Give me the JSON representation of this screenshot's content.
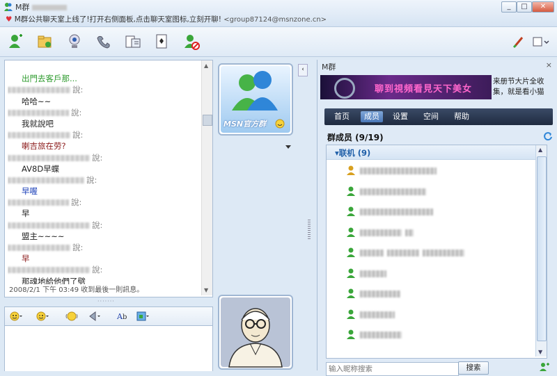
{
  "window": {
    "title": "M群",
    "announcement": "M群公共聊天室上线了!打开右侧面板,点击聊天室图标,立刻开聊!",
    "email": "<group87124@msnzone.cn>",
    "min_label": "_",
    "max_label": "□",
    "close_label": "✕"
  },
  "chat": {
    "lines": [
      {
        "kind": "sender",
        "text": "",
        "blur": 0
      },
      {
        "kind": "msg",
        "text": "出門去客戶那...",
        "color": "#2e9b2e"
      },
      {
        "kind": "sender",
        "text": "說:",
        "blur": 90
      },
      {
        "kind": "msg",
        "text": "哈哈~~",
        "color": "#222"
      },
      {
        "kind": "sender",
        "text": "說:",
        "blur": 88
      },
      {
        "kind": "msg",
        "text": "我就說吧",
        "color": "#222"
      },
      {
        "kind": "sender",
        "text": "說:",
        "blur": 90
      },
      {
        "kind": "msg",
        "text": "喇吉旅在劳?",
        "color": "#8b1a1a"
      },
      {
        "kind": "sender",
        "text": "說:",
        "blur": 118
      },
      {
        "kind": "msg",
        "text": "AV8D早蝶",
        "color": "#222"
      },
      {
        "kind": "sender",
        "text": "說:",
        "blur": 110
      },
      {
        "kind": "msg",
        "text": "早喔",
        "color": "#1a3fb8"
      },
      {
        "kind": "sender",
        "text": "說:",
        "blur": 88
      },
      {
        "kind": "msg",
        "text": "早",
        "color": "#222"
      },
      {
        "kind": "sender",
        "text": "說:",
        "blur": 118
      },
      {
        "kind": "msg",
        "text": "盟主~~~~",
        "color": "#222"
      },
      {
        "kind": "sender",
        "text": "說:",
        "blur": 90
      },
      {
        "kind": "msg",
        "text": "早",
        "color": "#8b1a1a"
      },
      {
        "kind": "sender",
        "text": "說:",
        "blur": 118
      },
      {
        "kind": "msg",
        "text": "那魂地給他們了劈",
        "color": "#222"
      }
    ],
    "status": "2008/2/1 下午 03:49 收到最後一則訊息。"
  },
  "middle": {
    "group_avatar_label": "MSN官方群"
  },
  "panel": {
    "header": "M群",
    "close": "×",
    "banner_text": "聊到視頻看見天下美女",
    "promo": "来册节大片全收集，就是看小猫",
    "tabs": [
      "首页",
      "成员",
      "设置",
      "空间",
      "帮助"
    ],
    "active_tab": 1,
    "members_title": "群成员 (9/19)",
    "group_name": "▾联机 (9)",
    "members": [
      {
        "status": "owner",
        "blur": [
          110
        ]
      },
      {
        "status": "online",
        "blur": [
          95
        ]
      },
      {
        "status": "online",
        "blur": [
          105
        ]
      },
      {
        "status": "online",
        "blur": [
          60,
          12
        ]
      },
      {
        "status": "online",
        "blur": [
          34,
          46,
          60
        ]
      },
      {
        "status": "online",
        "blur": [
          38
        ]
      },
      {
        "status": "online",
        "blur": [
          58
        ]
      },
      {
        "status": "online",
        "blur": [
          50
        ]
      },
      {
        "status": "online",
        "blur": [
          60
        ]
      }
    ],
    "search_placeholder": "输入昵称搜索",
    "search_button": "搜索"
  },
  "colors": {
    "online": "#3aa63a",
    "owner": "#d8a020",
    "accent": "#1f5fa8"
  }
}
